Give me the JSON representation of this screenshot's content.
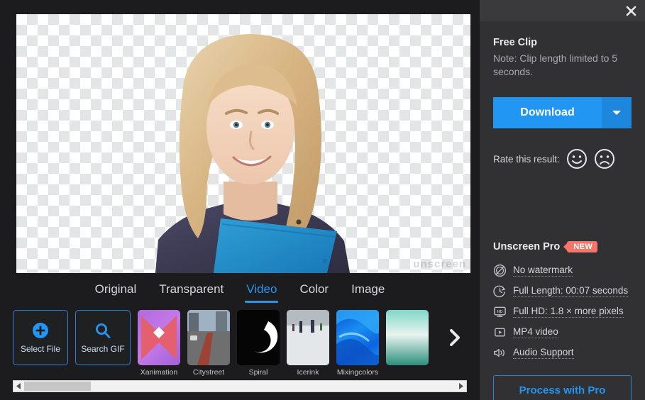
{
  "left": {
    "preview": {
      "alt": "Smiling blonde woman holding a blue folder on transparent background",
      "watermark": "unscreen"
    },
    "tabs": [
      {
        "label": "Original",
        "active": false
      },
      {
        "label": "Transparent",
        "active": false
      },
      {
        "label": "Video",
        "active": true
      },
      {
        "label": "Color",
        "active": false
      },
      {
        "label": "Image",
        "active": false
      }
    ],
    "actions": [
      {
        "label": "Select File",
        "icon": "plus-circle-icon"
      },
      {
        "label": "Search GIF",
        "icon": "search-icon"
      }
    ],
    "thumbnails": [
      {
        "label": "Xanimation",
        "art": "art-xanimation"
      },
      {
        "label": "Citystreet",
        "art": "art-citystreet"
      },
      {
        "label": "Spiral",
        "art": "art-spiral"
      },
      {
        "label": "Icerink",
        "art": "art-icerink"
      },
      {
        "label": "Mixingcolors",
        "art": "art-mixing"
      },
      {
        "label": "",
        "art": "art-partial"
      }
    ],
    "next_icon": "chevron-right-icon",
    "scrollbar": {
      "left_icon": "triangle-left-icon",
      "right_icon": "triangle-right-icon"
    }
  },
  "right": {
    "titlebar": {
      "close_icon": "close-icon"
    },
    "result": {
      "title": "Free Clip",
      "note": "Note: Clip length limited to 5 seconds.",
      "download_label": "Download",
      "download_caret_icon": "chevron-down-icon",
      "rate_label": "Rate this result:",
      "rate_happy_icon": "smiley-happy-icon",
      "rate_sad_icon": "smiley-sad-icon"
    },
    "pro": {
      "title": "Unscreen Pro",
      "badge": "NEW",
      "features": [
        {
          "text": "No watermark",
          "icon": "no-watermark-icon"
        },
        {
          "text": "Full Length: 00:07 seconds",
          "icon": "clock-icon"
        },
        {
          "text": "Full HD: 1.8 × more pixels",
          "icon": "hd-monitor-icon"
        },
        {
          "text": "MP4 video",
          "icon": "play-box-icon"
        },
        {
          "text": "Audio Support",
          "icon": "speaker-icon"
        }
      ],
      "button_label": "Process with Pro"
    }
  },
  "colors": {
    "accent_blue": "#2196f3",
    "badge_red": "#f4756a",
    "left_bg": "#1c1c1e",
    "right_bg": "#313134"
  }
}
